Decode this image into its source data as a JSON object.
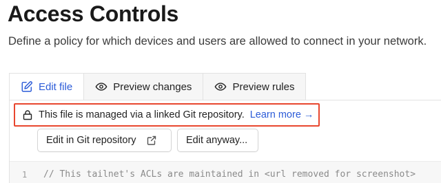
{
  "header": {
    "title": "Access Controls",
    "subtitle": "Define a policy for which devices and users are allowed to connect in your network."
  },
  "tabs": [
    {
      "label": "Edit file",
      "icon": "edit-icon",
      "active": true
    },
    {
      "label": "Preview changes",
      "icon": "eye-icon",
      "active": false
    },
    {
      "label": "Preview rules",
      "icon": "eye-icon",
      "active": false
    }
  ],
  "notice": {
    "icon": "lock-icon",
    "text": "This file is managed via a linked Git repository.",
    "link_label": "Learn more →"
  },
  "actions": {
    "edit_git_label": "Edit in Git repository",
    "edit_git_icon": "external-link-icon",
    "edit_anyway_label": "Edit anyway..."
  },
  "editor": {
    "lines": [
      {
        "number": "1",
        "text": "// This tailnet's ACLs are maintained in <url removed for screenshot>"
      }
    ]
  },
  "colors": {
    "accent": "#2b5bd8",
    "highlight_border": "#e8462e"
  }
}
